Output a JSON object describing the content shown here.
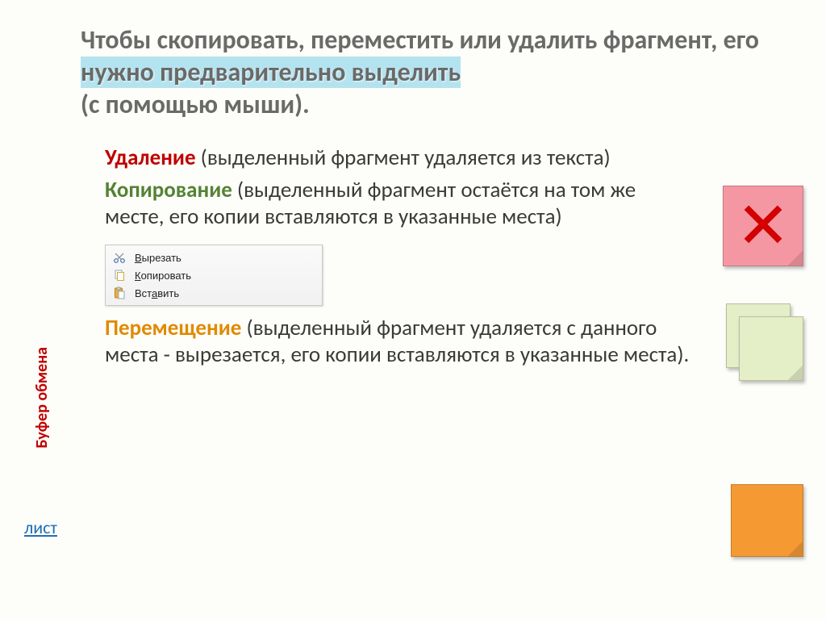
{
  "title": {
    "line1": "Чтобы скопировать, переместить или удалить фрагмент, его ",
    "highlight1": "нужно предварительно ",
    "highlight2_bold": "выделить",
    "line2": "(",
    "line2_rest": "с помощью мыши)."
  },
  "sections": {
    "delete": {
      "term": "Удаление",
      "text": " (выделенный фрагмент удаляется из текста)"
    },
    "copy": {
      "term": "Копирование",
      "text": " (выделенный фрагмент остаётся на том же месте,  его копии вставляются в указанные места)"
    },
    "move": {
      "term": "Перемещение",
      "text": " (выделенный фрагмент удаляется с данного места -  вырезается, его копии вставляются в указанные места)."
    }
  },
  "context_menu": {
    "cut": {
      "label_pre": "",
      "label_u": "В",
      "label_post": "ырезать"
    },
    "copy": {
      "label_pre": "",
      "label_u": "К",
      "label_post": "опировать"
    },
    "paste": {
      "label_pre": "Вст",
      "label_u": "а",
      "label_post": "вить"
    }
  },
  "side_label": "Буфер обмена",
  "list_link": "лист",
  "icons": {
    "scissors": "scissors-icon",
    "copy": "copy-icon",
    "paste": "paste-icon",
    "cross": "✕"
  }
}
